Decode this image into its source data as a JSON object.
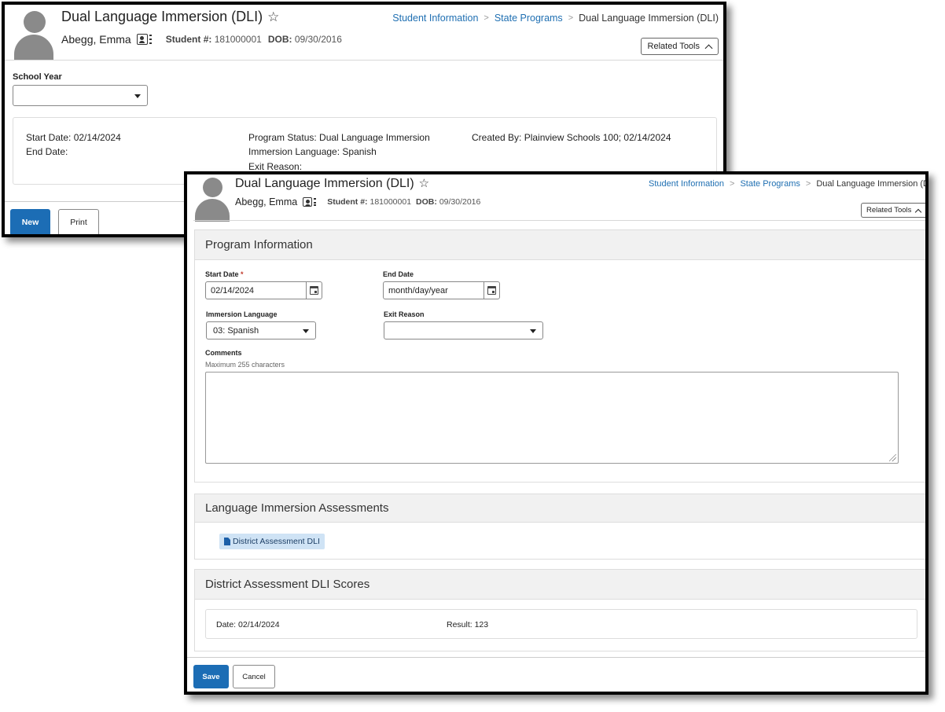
{
  "back_window": {
    "header": {
      "title": "Dual Language Immersion (DLI)",
      "student_name": "Abegg, Emma",
      "student_number_label": "Student #:",
      "student_number": "181000001",
      "dob_label": "DOB:",
      "dob": "09/30/2016",
      "related_tools": "Related Tools"
    },
    "breadcrumb": [
      "Student Information",
      "State Programs",
      "Dual Language Immersion (DLI)"
    ],
    "school_year": {
      "label": "School Year",
      "value": ""
    },
    "summary": {
      "start_date": "Start Date: 02/14/2024",
      "end_date": "End Date:",
      "program_status": "Program Status: Dual Language Immersion",
      "immersion_language": "Immersion Language: Spanish",
      "exit_reason": "Exit Reason:",
      "created_by": "Created By: Plainview Schools 100; 02/14/2024"
    },
    "buttons": {
      "new": "New",
      "print": "Print"
    }
  },
  "front_window": {
    "header": {
      "title": "Dual Language Immersion (DLI)",
      "student_name": "Abegg, Emma",
      "student_number_label": "Student #:",
      "student_number": "181000001",
      "dob_label": "DOB:",
      "dob": "09/30/2016",
      "related_tools": "Related Tools"
    },
    "breadcrumb": [
      "Student Information",
      "State Programs",
      "Dual Language Immersion (DL"
    ],
    "program_information": {
      "heading": "Program Information",
      "start_date_label": "Start Date",
      "start_date_required": "*",
      "start_date_value": "02/14/2024",
      "end_date_label": "End Date",
      "end_date_value": "month/day/year",
      "immersion_language_label": "Immersion Language",
      "immersion_language_value": "03: Spanish",
      "exit_reason_label": "Exit Reason",
      "exit_reason_value": "",
      "comments_label": "Comments",
      "comments_hint": "Maximum 255 characters"
    },
    "assessments": {
      "heading": "Language Immersion Assessments",
      "item": "District Assessment DLI"
    },
    "scores": {
      "heading": "District Assessment DLI Scores",
      "date": "Date: 02/14/2024",
      "result": "Result: 123"
    },
    "buttons": {
      "save": "Save",
      "cancel": "Cancel"
    }
  },
  "colors": {
    "primary_button": "#1c6db5",
    "link": "#1f6fb2",
    "chip": "#cfe3f5"
  }
}
